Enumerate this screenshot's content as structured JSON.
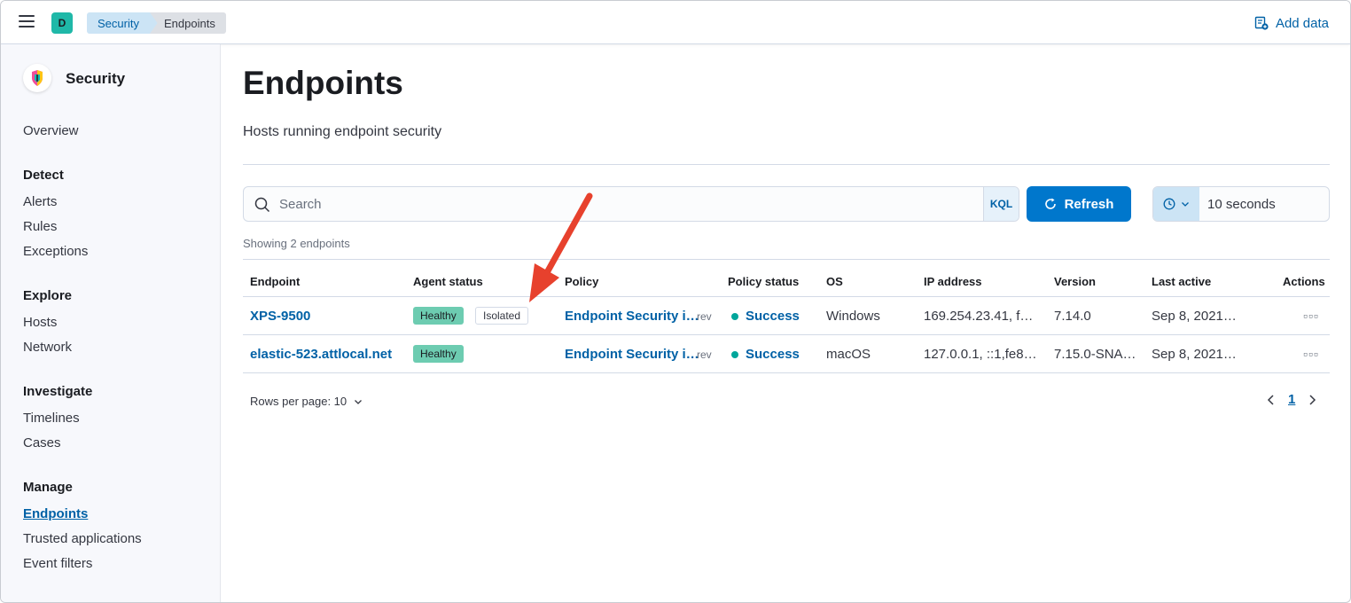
{
  "header": {
    "space_initial": "D",
    "breadcrumbs": [
      "Security",
      "Endpoints"
    ],
    "add_data_label": "Add data"
  },
  "sidebar": {
    "title": "Security",
    "overview": "Overview",
    "groups": [
      {
        "label": "Detect",
        "items": [
          "Alerts",
          "Rules",
          "Exceptions"
        ]
      },
      {
        "label": "Explore",
        "items": [
          "Hosts",
          "Network"
        ]
      },
      {
        "label": "Investigate",
        "items": [
          "Timelines",
          "Cases"
        ]
      },
      {
        "label": "Manage",
        "items": [
          "Endpoints",
          "Trusted applications",
          "Event filters"
        ]
      }
    ],
    "active_item": "Endpoints"
  },
  "main": {
    "title": "Endpoints",
    "description": "Hosts running endpoint security",
    "search": {
      "placeholder": "Search",
      "kql_label": "KQL"
    },
    "refresh_label": "Refresh",
    "refresh_interval": "10 seconds",
    "showing_text": "Showing 2 endpoints",
    "table": {
      "columns": [
        "Endpoint",
        "Agent status",
        "Policy",
        "Policy status",
        "OS",
        "IP address",
        "Version",
        "Last active",
        "Actions"
      ],
      "rows": [
        {
          "endpoint": "XPS-9500",
          "agent_status": "Healthy",
          "isolation": "Isolated",
          "policy": "Endpoint Security i…",
          "rev": "rev",
          "policy_status": "Success",
          "os": "Windows",
          "ip": "169.254.23.41, f…",
          "version": "7.14.0",
          "last_active": "Sep 8, 2021…",
          "actions": "▫▫▫"
        },
        {
          "endpoint": "elastic-523.attlocal.net",
          "agent_status": "Healthy",
          "isolation": "",
          "policy": "Endpoint Security i…",
          "rev": "rev",
          "policy_status": "Success",
          "os": "macOS",
          "ip": "127.0.0.1, ::1,fe8…",
          "version": "7.15.0-SNA…",
          "last_active": "Sep 8, 2021…",
          "actions": "▫▫▫"
        }
      ]
    },
    "rows_per_page": "Rows per page: 10",
    "current_page": "1"
  },
  "colors": {
    "primary": "#0077cc",
    "link": "#0061a6",
    "healthy_badge": "#6dccb1",
    "success_dot": "#00a69b",
    "annotation_arrow": "#e7412d"
  }
}
